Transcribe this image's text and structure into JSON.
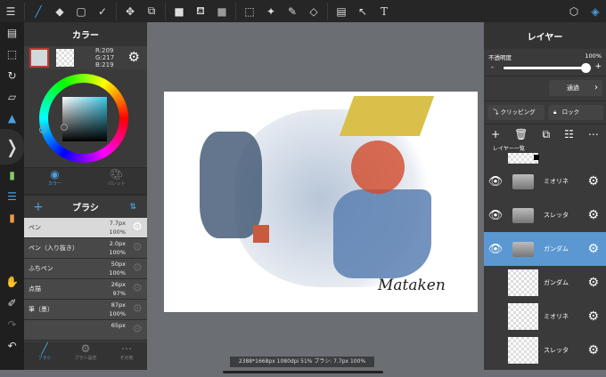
{
  "toolbar": {
    "icons": [
      "menu-icon",
      "brush-icon",
      "eraser-icon",
      "rectangle-icon",
      "select-check-icon",
      "move-icon",
      "transform-icon",
      "fill-color-icon",
      "bucket-icon",
      "gradient-icon",
      "marquee-icon",
      "magic-wand-icon",
      "select-pen-icon",
      "select-eraser-icon",
      "layout-icon",
      "select-arrow-icon",
      "text-icon",
      "materials-icon",
      "layers-icon"
    ],
    "text_glyph": "T"
  },
  "color_panel": {
    "title": "カラー",
    "r": "R:209",
    "g": "G:217",
    "b": "B:219",
    "tab_color": "カラー",
    "tab_palette": "パレット",
    "fg_color": "#d1d9db"
  },
  "brush_panel": {
    "title": "ブラシ",
    "items": [
      {
        "name": "ペン",
        "size": "7.7px",
        "opacity": "100%"
      },
      {
        "name": "ペン（入り抜き）",
        "size": "2.0px",
        "opacity": "100%"
      },
      {
        "name": "ふちペン",
        "size": "50px",
        "opacity": "100%"
      },
      {
        "name": "点描",
        "size": "26px",
        "opacity": "97%"
      },
      {
        "name": "筆（墨）",
        "size": "87px",
        "opacity": "100%"
      },
      {
        "name": "",
        "size": "65px",
        "opacity": ""
      }
    ],
    "tabs": [
      "ブラシ",
      "ブラシ設定",
      "その他"
    ]
  },
  "layer_panel": {
    "title": "レイヤー",
    "opacity_label": "不透明度",
    "opacity_value": "100%",
    "opacity": 1.0,
    "minus": "-",
    "plus": "+",
    "blend": "通過",
    "clipping": "クリッピング",
    "lock": "ロック",
    "list_label": "レイヤー一覧",
    "layers": [
      {
        "name": "ミオリネ",
        "type": "folder",
        "visible": true
      },
      {
        "name": "スレッタ",
        "type": "folder",
        "visible": true
      },
      {
        "name": "ガンダム",
        "type": "folder",
        "visible": true,
        "selected": true
      },
      {
        "name": "ガンダム",
        "type": "layer"
      },
      {
        "name": "ミオリネ",
        "type": "layer"
      },
      {
        "name": "スレッタ",
        "type": "layer"
      }
    ]
  },
  "status": "2388*1668px 1080dpi 51% ブラシ: 7.7px 100%",
  "canvas": {
    "signature": "Mataken"
  },
  "accent": "#5b97d1"
}
